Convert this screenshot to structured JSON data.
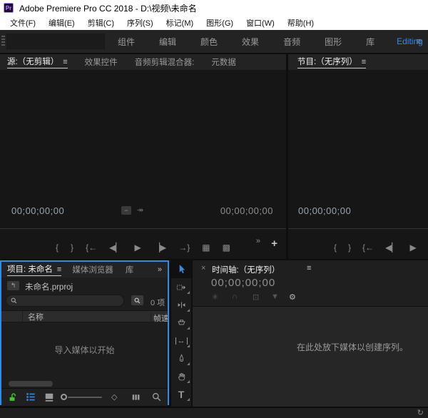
{
  "titlebar": {
    "logo": "Pr",
    "title": "Adobe Premiere Pro CC 2018 - D:\\视频\\未命名"
  },
  "menubar": {
    "items": [
      "文件(F)",
      "编辑(E)",
      "剪辑(C)",
      "序列(S)",
      "标记(M)",
      "图形(G)",
      "窗口(W)",
      "帮助(H)"
    ]
  },
  "workspace": {
    "tabs": [
      "组件",
      "编辑",
      "颜色",
      "效果",
      "音频",
      "图形",
      "库"
    ],
    "active": "Editing",
    "panel_menu": "≡"
  },
  "source": {
    "tab_active": "源:（无剪辑）",
    "panel_menu": "≡",
    "tab_effects": "效果控件",
    "tab_mixer": "音频剪辑混合器:",
    "tab_metadata": "元数据",
    "tc_current": "00;00;00;00",
    "tc_duration": "00;00;00;00",
    "fit_glyph": "−",
    "scrub_glyph": "↠",
    "t_mark_in": "{",
    "t_mark_out": "}",
    "t_go_in": "{←",
    "t_step_back": "◀▏",
    "t_play": "▶",
    "t_step_fwd": "▕▶",
    "t_go_out": "→}",
    "t_insert": "▦",
    "t_overwrite": "▩",
    "t_more": "»",
    "t_add": "+"
  },
  "program": {
    "tab": "节目:（无序列）",
    "panel_menu": "≡",
    "tc_current": "00;00;00;00",
    "t_mark_in": "{",
    "t_mark_out": "}",
    "t_go_in": "{←",
    "t_step_back": "◀▏",
    "t_play": "▶"
  },
  "project": {
    "tab_active": "项目: 未命名",
    "panel_menu": "≡",
    "tab_browser": "媒体浏览器",
    "tab_libraries": "库",
    "overflow": "»",
    "up_glyph": "↰",
    "filename": "未命名.prproj",
    "count": "0 项",
    "col_name": "名称",
    "col_rate": "帧速率",
    "empty": "导入媒体以开始",
    "sort_glyph": "◇"
  },
  "tools": {
    "slip_glyph": "↔",
    "type_glyph": "T"
  },
  "timeline": {
    "close": "×",
    "tab": "时间轴:（无序列）",
    "panel_menu": "≡",
    "tc": "00;00;00;00",
    "nest_glyph": "✳",
    "snap_glyph": "∩",
    "link_glyph": "⊡",
    "marker_glyph": "▼",
    "wrench_glyph": "⚙",
    "empty": "在此处放下媒体以创建序列。"
  },
  "statusbar": {
    "events_glyph": "↻"
  },
  "colors": {
    "accent": "#2d8ceb",
    "focus_border": "#2d8ceb",
    "lock_green": "#43c32f",
    "titlebar_bg": "#ffffff",
    "panel_bg": "#232323"
  }
}
